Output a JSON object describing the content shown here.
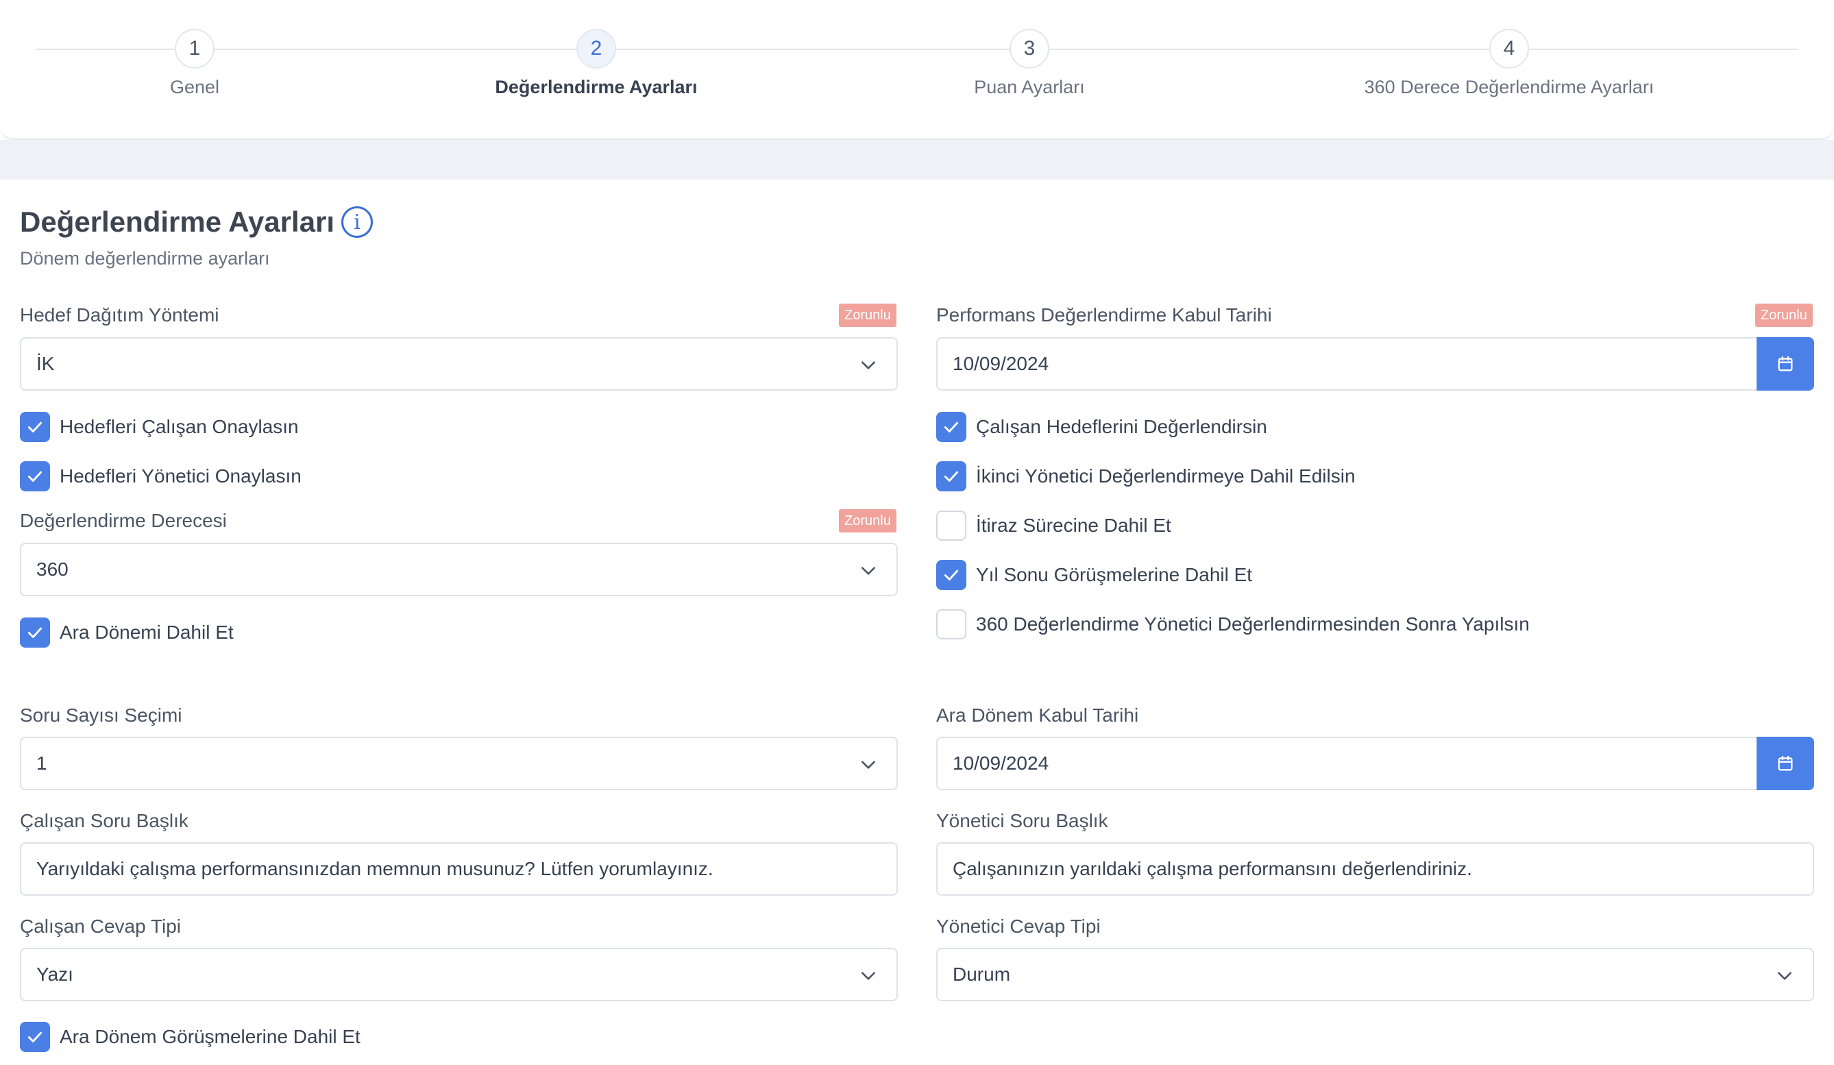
{
  "stepper": {
    "steps": [
      {
        "number": "1",
        "label": "Genel",
        "active": false
      },
      {
        "number": "2",
        "label": "Değerlendirme Ayarları",
        "active": true
      },
      {
        "number": "3",
        "label": "Puan Ayarları",
        "active": false
      },
      {
        "number": "4",
        "label": "360 Derece Değerlendirme Ayarları",
        "active": false
      }
    ]
  },
  "page": {
    "title": "Değerlendirme Ayarları",
    "info_icon": "info-icon",
    "subtitle": "Dönem değerlendirme ayarları"
  },
  "required_badge": "Zorunlu",
  "left": {
    "distribution": {
      "label": "Hedef Dağıtım Yöntemi",
      "value": "İK"
    },
    "approve_employee": {
      "label": "Hedefleri Çalışan Onaylasın",
      "checked": true
    },
    "approve_manager": {
      "label": "Hedefleri Yönetici Onaylasın",
      "checked": true
    },
    "degree": {
      "label": "Değerlendirme Derecesi",
      "value": "360"
    },
    "include_interim": {
      "label": "Ara Dönemi Dahil Et",
      "checked": true
    },
    "question_count": {
      "label": "Soru Sayısı Seçimi",
      "value": "1"
    },
    "employee_question": {
      "label": "Çalışan Soru Başlık",
      "value": "Yarıyıldaki çalışma performansınızdan memnun musunuz? Lütfen yorumlayınız."
    },
    "employee_answer_type": {
      "label": "Çalışan Cevap Tipi",
      "value": "Yazı"
    },
    "include_interim_meetings": {
      "label": "Ara Dönem Görüşmelerine Dahil Et",
      "checked": true
    }
  },
  "right": {
    "acceptance_date": {
      "label": "Performans Değerlendirme Kabul Tarihi",
      "value": "10/09/2024"
    },
    "employee_evaluate": {
      "label": "Çalışan Hedeflerini Değerlendirsin",
      "checked": true
    },
    "second_manager": {
      "label": "İkinci Yönetici Değerlendirmeye Dahil Edilsin",
      "checked": true
    },
    "objection": {
      "label": "İtiraz Sürecine Dahil Et",
      "checked": false
    },
    "year_end": {
      "label": "Yıl Sonu Görüşmelerine Dahil Et",
      "checked": true
    },
    "after_manager": {
      "label": "360 Değerlendirme Yönetici Değerlendirmesinden Sonra Yapılsın",
      "checked": false
    },
    "interim_date": {
      "label": "Ara Dönem Kabul Tarihi",
      "value": "10/09/2024"
    },
    "manager_question": {
      "label": "Yönetici Soru Başlık",
      "value": "Çalışanınızın yarıldaki çalışma performansını değerlendiriniz."
    },
    "manager_answer_type": {
      "label": "Yönetici Cevap Tipi",
      "value": "Durum"
    }
  },
  "colors": {
    "accent": "#4a80e8",
    "badge": "#f0a29b",
    "step_active": "#3b6fd6"
  }
}
